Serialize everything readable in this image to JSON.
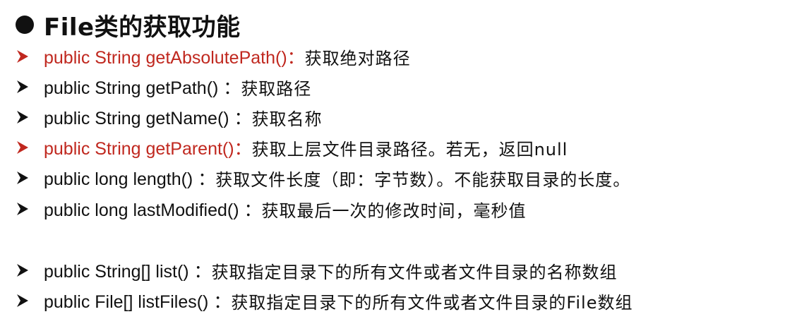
{
  "heading": "File类的获取功能",
  "items": [
    {
      "signature": "public String getAbsolutePath()：",
      "description": "获取绝对路径",
      "highlighted": true
    },
    {
      "signature": "public String getPath() ：",
      "description": "获取路径",
      "highlighted": false
    },
    {
      "signature": "public String getName() ：",
      "description": "获取名称",
      "highlighted": false
    },
    {
      "signature": "public String getParent()：",
      "description": "获取上层文件目录路径。若无，返回null",
      "highlighted": true
    },
    {
      "signature": "public long length() ：",
      "description": "获取文件长度（即：字节数）。不能获取目录的长度。",
      "highlighted": false
    },
    {
      "signature": "public long lastModified() ：",
      "description": "获取最后一次的修改时间，毫秒值",
      "highlighted": false
    },
    {
      "signature": "public String[] list() ：",
      "description": "获取指定目录下的所有文件或者文件目录的名称数组",
      "highlighted": false
    },
    {
      "signature": "public File[] listFiles() ：",
      "description": "获取指定目录下的所有文件或者文件目录的File数组",
      "highlighted": false
    }
  ],
  "colors": {
    "highlight": "#c0281f",
    "text": "#111111",
    "background": "#ffffff"
  }
}
